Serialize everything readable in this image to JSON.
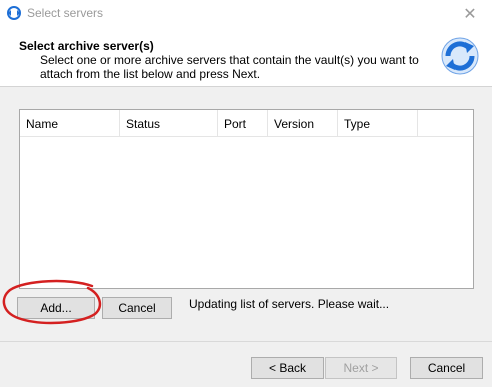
{
  "window": {
    "title": "Select servers",
    "close_glyph": "✕"
  },
  "header": {
    "title": "Select archive server(s)",
    "description": "Select one or more archive servers that contain the vault(s) you want to attach from the list below and press Next.",
    "icon": "refresh-arrows-icon"
  },
  "list": {
    "columns": [
      "Name",
      "Status",
      "Port",
      "Version",
      "Type",
      ""
    ],
    "rows": []
  },
  "actions": {
    "add_label": "Add...",
    "cancel_label": "Cancel"
  },
  "status_message": "Updating list of servers. Please wait...",
  "footer": {
    "back_label": "< Back",
    "next_label": "Next >",
    "cancel_label": "Cancel"
  },
  "colors": {
    "annotation": "#d42020",
    "icon_blue": "#1e6fd6"
  }
}
